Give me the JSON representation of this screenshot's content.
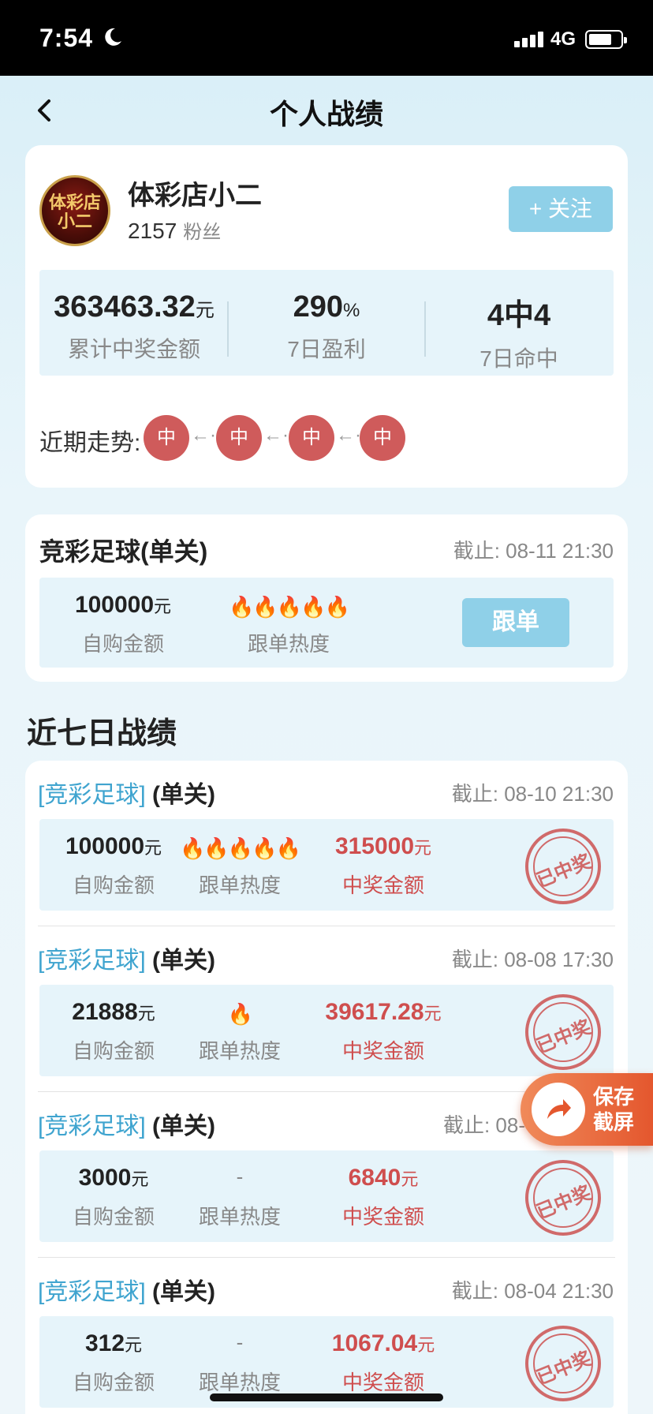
{
  "status": {
    "time": "7:54",
    "network": "4G"
  },
  "nav": {
    "title": "个人战绩"
  },
  "profile": {
    "avatar_text": "体彩店小二",
    "name": "体彩店小二",
    "fans_count": "2157",
    "fans_label": "粉丝",
    "follow_label": "+ 关注",
    "stats": [
      {
        "value": "363463.32",
        "unit": "元",
        "label": "累计中奖金额"
      },
      {
        "value": "290",
        "unit": "%",
        "label": "7日盈利"
      },
      {
        "value": "4中4",
        "unit": "",
        "label": "7日命中"
      }
    ],
    "trend_label": "近期走势:",
    "trend": [
      "中",
      "中",
      "中",
      "中"
    ],
    "trend_arrow": "←··"
  },
  "current_bet": {
    "title": "竞彩足球(单关)",
    "deadline": "截止: 08-11 21:30",
    "amount": "100000",
    "unit": "元",
    "amount_label": "自购金额",
    "heat": "🔥🔥🔥🔥🔥",
    "heat_label": "跟单热度",
    "follow_label": "跟单"
  },
  "history_title": "近七日战绩",
  "history": [
    {
      "category": "[竞彩足球]",
      "mode": "(单关)",
      "deadline": "截止: 08-10 21:30",
      "amount": "100000",
      "unit": "元",
      "amount_label": "自购金额",
      "heat": "🔥🔥🔥🔥🔥",
      "heat_label": "跟单热度",
      "win": "315000",
      "win_label": "中奖金额",
      "stamp": "已中奖"
    },
    {
      "category": "[竞彩足球]",
      "mode": "(单关)",
      "deadline": "截止: 08-08 17:30",
      "amount": "21888",
      "unit": "元",
      "amount_label": "自购金额",
      "heat": "🔥",
      "heat_label": "跟单热度",
      "win": "39617.28",
      "win_label": "中奖金额",
      "stamp": "已中奖"
    },
    {
      "category": "[竞彩足球]",
      "mode": "(单关)",
      "deadline": "截止: 08-",
      "amount": "3000",
      "unit": "元",
      "amount_label": "自购金额",
      "heat": "-",
      "heat_label": "跟单热度",
      "win": "6840",
      "win_label": "中奖金额",
      "stamp": "已中奖"
    },
    {
      "category": "[竞彩足球]",
      "mode": "(单关)",
      "deadline": "截止: 08-04 21:30",
      "amount": "312",
      "unit": "元",
      "amount_label": "自购金额",
      "heat": "-",
      "heat_label": "跟单热度",
      "win": "1067.04",
      "win_label": "中奖金额",
      "stamp": "已中奖"
    }
  ],
  "save_button": {
    "label": "保存截屏"
  },
  "colors": {
    "accent": "#8fd0e8",
    "win": "#cf4e4e",
    "category": "#3fa4cf",
    "trend": "#cf5b5b"
  }
}
